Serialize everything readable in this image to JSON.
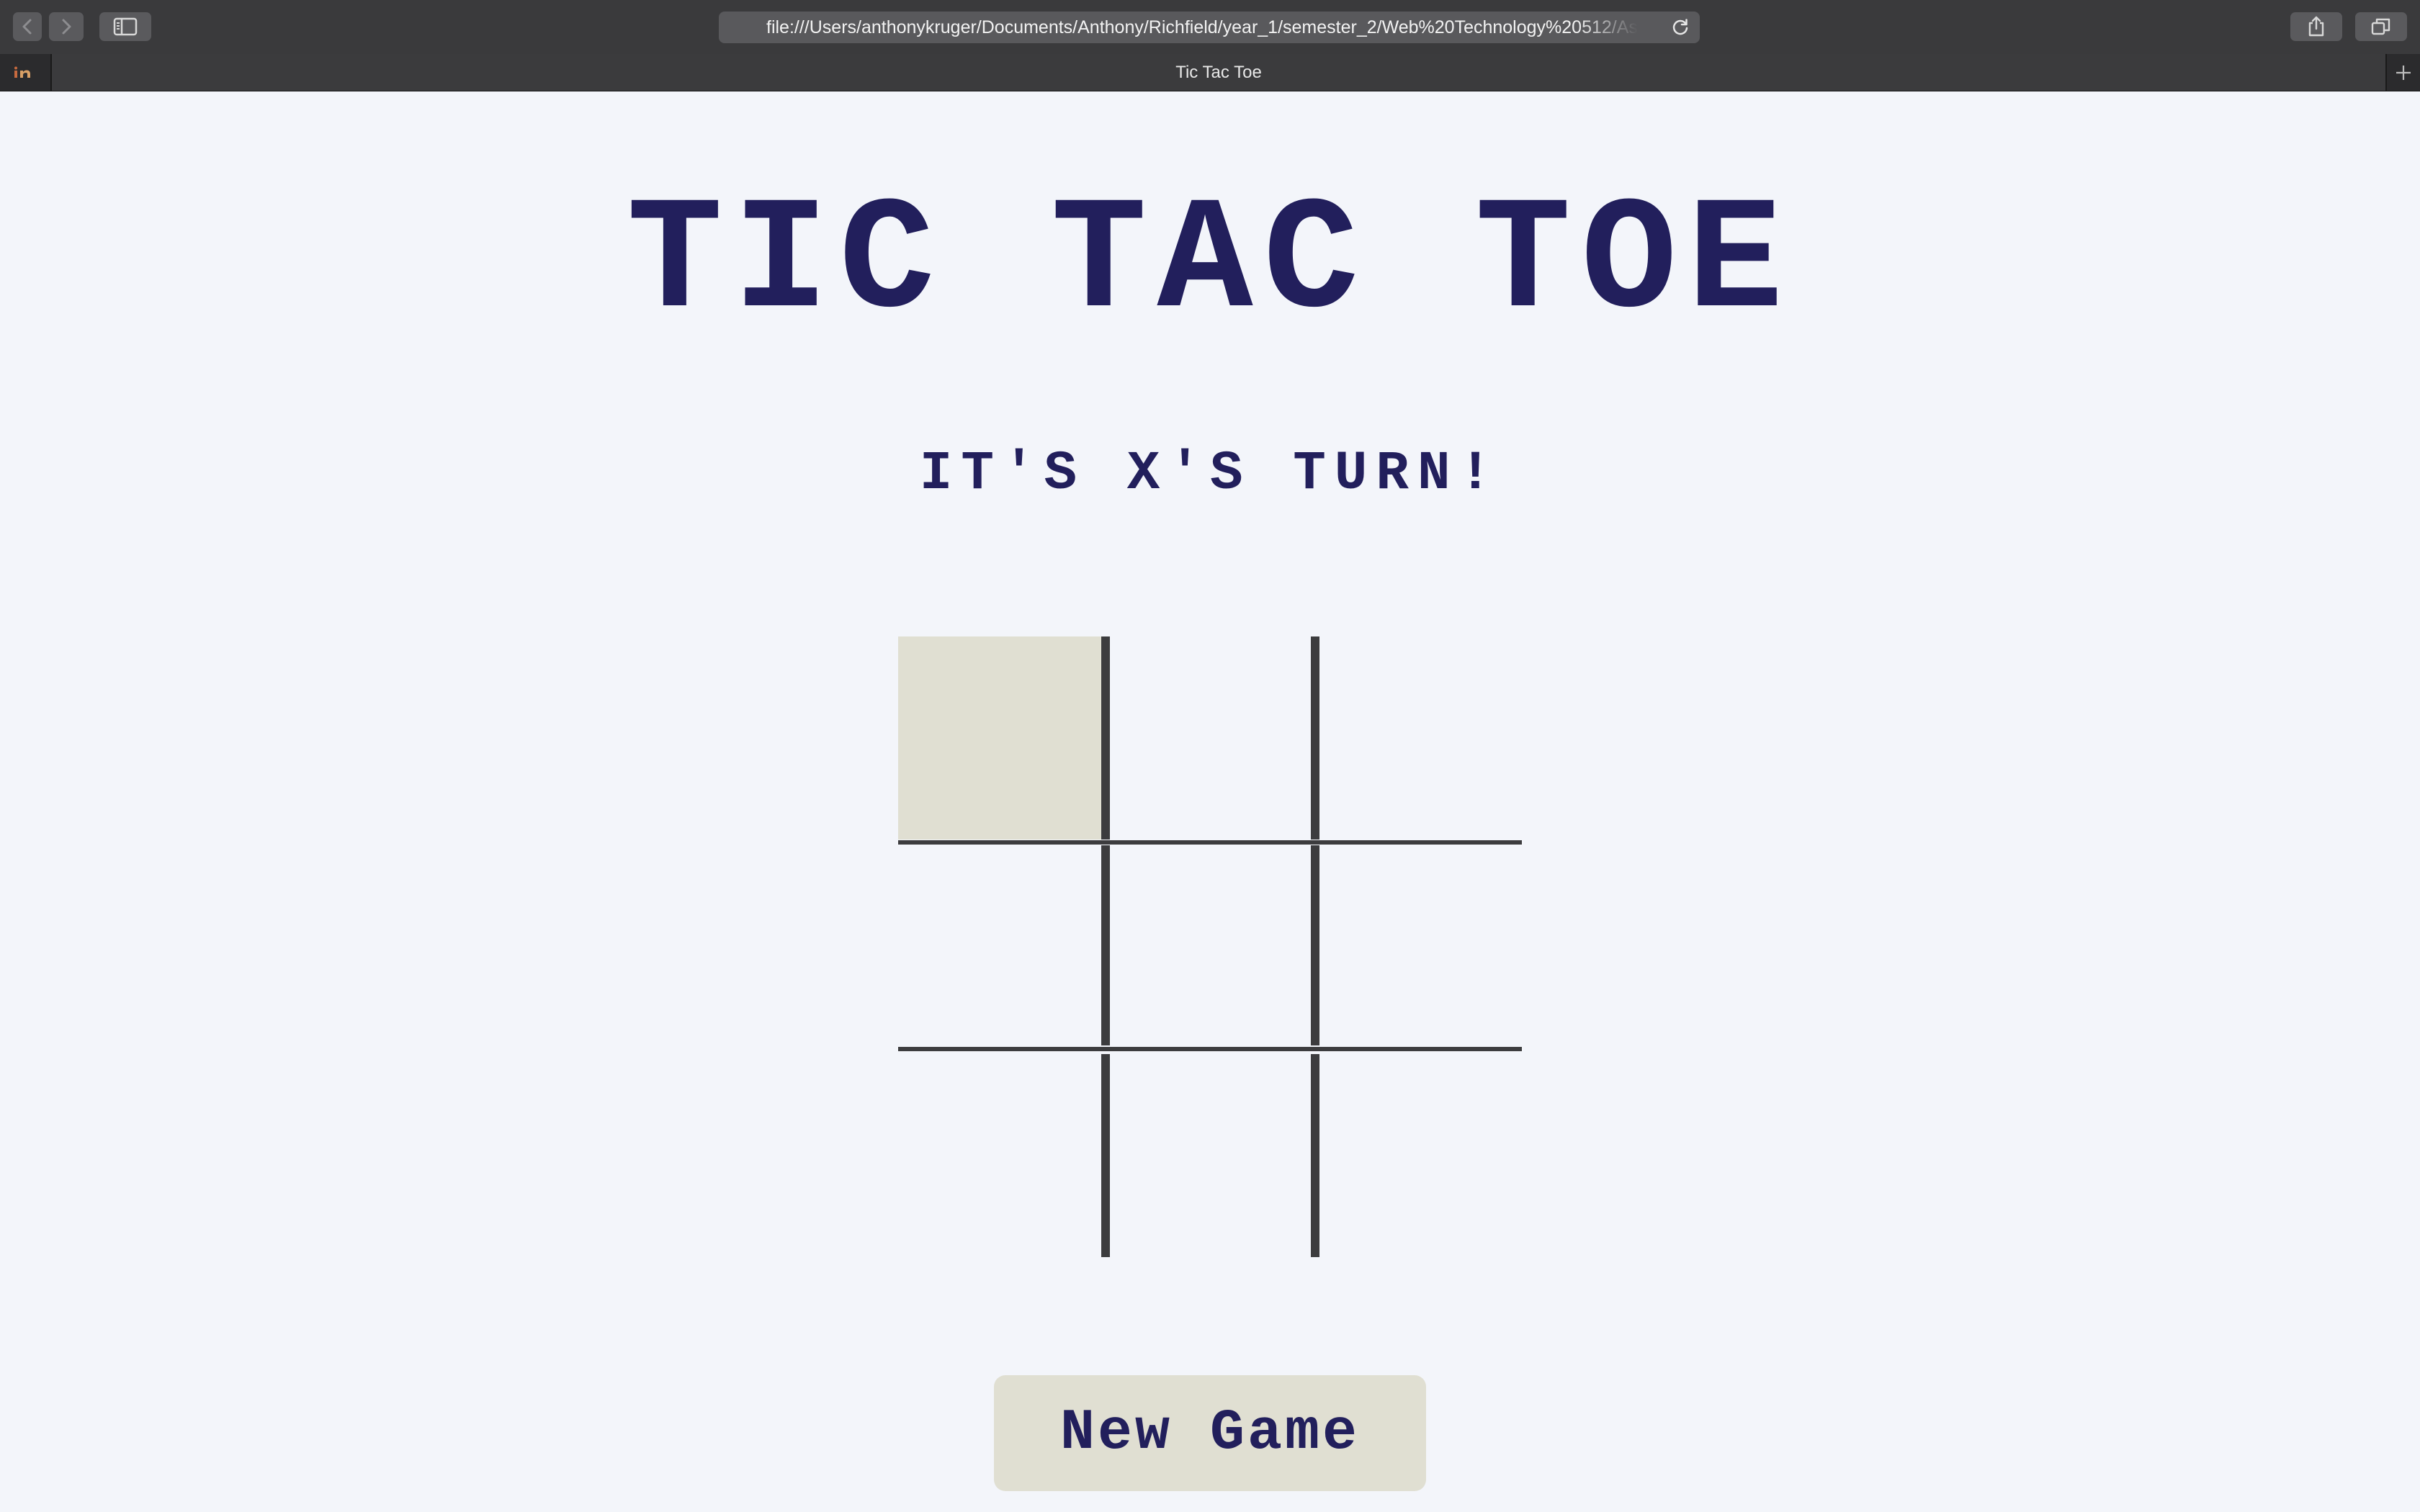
{
  "browser": {
    "url": "file:///Users/anthonykruger/Documents/Anthony/Richfield/year_1/semester_2/Web%20Technology%20512/Ass",
    "tab_title": "Tic Tac Toe",
    "pinned_tab_icon": "invision-favicon",
    "icons": [
      "back-icon",
      "forward-icon",
      "sidebar-icon",
      "reload-icon",
      "share-icon",
      "tabs-overview-icon",
      "new-tab-icon"
    ]
  },
  "game": {
    "title": "TIC TAC TOE",
    "status": "IT'S X'S TURN!",
    "board": {
      "cells": [
        "",
        "",
        "",
        "",
        "",
        "",
        "",
        "",
        ""
      ],
      "hovered_cell": 0
    },
    "new_game_label": "New Game"
  },
  "colors": {
    "page_background": "#f3f5fa",
    "text_navy": "#221f5c",
    "cell_hover": "#e0dfd2",
    "button_background": "#e0dfd2",
    "grid_lines": "#3c3c3e",
    "chrome_toolbar": "#3a3a3c",
    "chrome_tabbar": "#2b2b2d"
  }
}
